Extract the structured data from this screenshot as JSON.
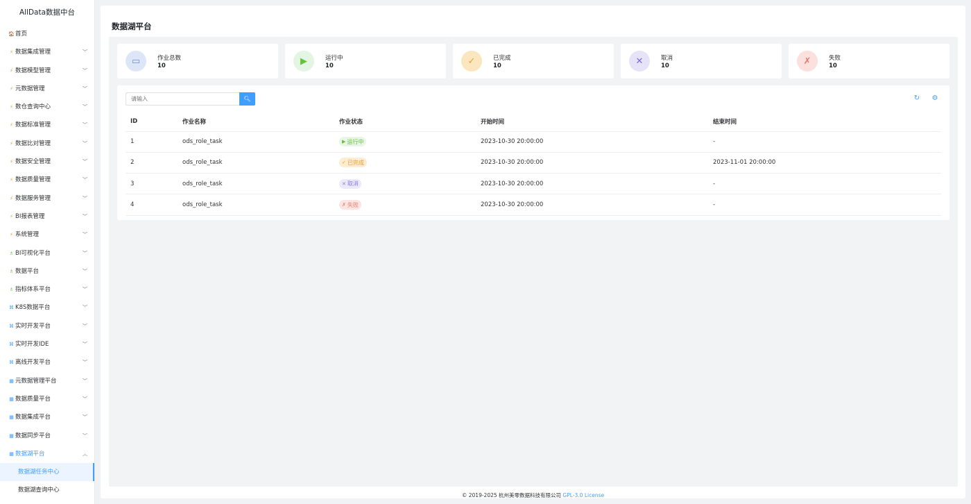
{
  "app": {
    "brand": "AllData数据中台"
  },
  "sidebar": {
    "items": [
      {
        "icon": "🏠",
        "icon_name": "home-icon",
        "label": "首页",
        "expandable": false
      },
      {
        "icon": "⚡",
        "icon_name": "bolt-icon",
        "label": "数据集成管理",
        "expandable": true
      },
      {
        "icon": "⚡",
        "icon_name": "bolt-icon",
        "label": "数据模型管理",
        "expandable": true
      },
      {
        "icon": "⚡",
        "icon_name": "bolt-icon",
        "label": "元数据管理",
        "expandable": true
      },
      {
        "icon": "⚡",
        "icon_name": "bolt-icon",
        "label": "数仓查询中心",
        "expandable": true
      },
      {
        "icon": "⚡",
        "icon_name": "bolt-icon",
        "label": "数据标准管理",
        "expandable": true
      },
      {
        "icon": "⚡",
        "icon_name": "bolt-icon",
        "label": "数据比对管理",
        "expandable": true
      },
      {
        "icon": "⚡",
        "icon_name": "bolt-icon",
        "label": "数据安全管理",
        "expandable": true
      },
      {
        "icon": "⚡",
        "icon_name": "bolt-icon",
        "label": "数据质量管理",
        "expandable": true
      },
      {
        "icon": "⚡",
        "icon_name": "bolt-icon",
        "label": "数据服务管理",
        "expandable": true
      },
      {
        "icon": "⚡",
        "icon_name": "bolt-icon",
        "label": "BI报表管理",
        "expandable": true
      },
      {
        "icon": "⚡",
        "icon_name": "bolt-icon",
        "label": "系统管理",
        "expandable": true
      },
      {
        "icon": "♗",
        "icon_name": "person-icon",
        "label": "BI可视化平台",
        "expandable": true
      },
      {
        "icon": "♗",
        "icon_name": "person-icon",
        "label": "数据平台",
        "expandable": true
      },
      {
        "icon": "♗",
        "icon_name": "person-icon",
        "label": "指标体系平台",
        "expandable": true
      },
      {
        "icon": "⌘",
        "icon_name": "network-icon",
        "label": "K8S数据平台",
        "expandable": true
      },
      {
        "icon": "⌘",
        "icon_name": "network-icon",
        "label": "实时开发平台",
        "expandable": true
      },
      {
        "icon": "⌘",
        "icon_name": "network-icon",
        "label": "实时开发IDE",
        "expandable": true
      },
      {
        "icon": "⌘",
        "icon_name": "network-icon",
        "label": "离线开发平台",
        "expandable": true
      },
      {
        "icon": "▦",
        "icon_name": "grid-icon",
        "label": "元数据管理平台",
        "expandable": true
      },
      {
        "icon": "▦",
        "icon_name": "grid-icon",
        "label": "数据质量平台",
        "expandable": true
      },
      {
        "icon": "▦",
        "icon_name": "grid-icon",
        "label": "数据集成平台",
        "expandable": true
      },
      {
        "icon": "▦",
        "icon_name": "grid-icon",
        "label": "数据同步平台",
        "expandable": true
      },
      {
        "icon": "▦",
        "icon_name": "grid-icon",
        "label": "数据湖平台",
        "expandable": true,
        "open": true
      }
    ],
    "submenu": [
      {
        "label": "数据湖任务中心",
        "active": true
      },
      {
        "label": "数据湖查询中心",
        "active": false
      }
    ]
  },
  "page": {
    "title": "数据湖平台"
  },
  "stats": [
    {
      "label": "作业总数",
      "value": "10",
      "icon": "inbox-icon",
      "glyph": "▭",
      "bg": "#dce6f7",
      "fg": "#6f8fd6"
    },
    {
      "label": "运行中",
      "value": "10",
      "icon": "play-icon",
      "glyph": "▶",
      "bg": "#e3f6e4",
      "fg": "#67c23a"
    },
    {
      "label": "已完成",
      "value": "10",
      "icon": "check-circle-icon",
      "glyph": "✓",
      "bg": "#fbe7bf",
      "fg": "#e6a23c"
    },
    {
      "label": "取消",
      "value": "10",
      "icon": "cancel-circle-icon",
      "glyph": "✕",
      "bg": "#e6e3f8",
      "fg": "#7b6ad8"
    },
    {
      "label": "失败",
      "value": "10",
      "icon": "fail-icon",
      "glyph": "✗",
      "bg": "#fbe0de",
      "fg": "#e67a6a"
    }
  ],
  "search": {
    "placeholder": "请输入"
  },
  "table": {
    "columns": [
      "ID",
      "作业名称",
      "作业状态",
      "开始时间",
      "结束时间"
    ],
    "rows": [
      {
        "id": "1",
        "name": "ods_role_task",
        "status": "运行中",
        "status_type": "running",
        "start": "2023-10-30 20:00:00",
        "end": "-"
      },
      {
        "id": "2",
        "name": "ods_role_task",
        "status": "已完成",
        "status_type": "done",
        "start": "2023-10-30 20:00:00",
        "end": "2023-11-01 20:00:00"
      },
      {
        "id": "3",
        "name": "ods_role_task",
        "status": "取消",
        "status_type": "cancel",
        "start": "2023-10-30 20:00:00",
        "end": "-"
      },
      {
        "id": "4",
        "name": "ods_role_task",
        "status": "失败",
        "status_type": "fail",
        "start": "2023-10-30 20:00:00",
        "end": "-"
      }
    ]
  },
  "footer": {
    "copyright": "© 2019-2025 杭州美零数据科技有限公司",
    "license": "GPL-3.0 License"
  }
}
